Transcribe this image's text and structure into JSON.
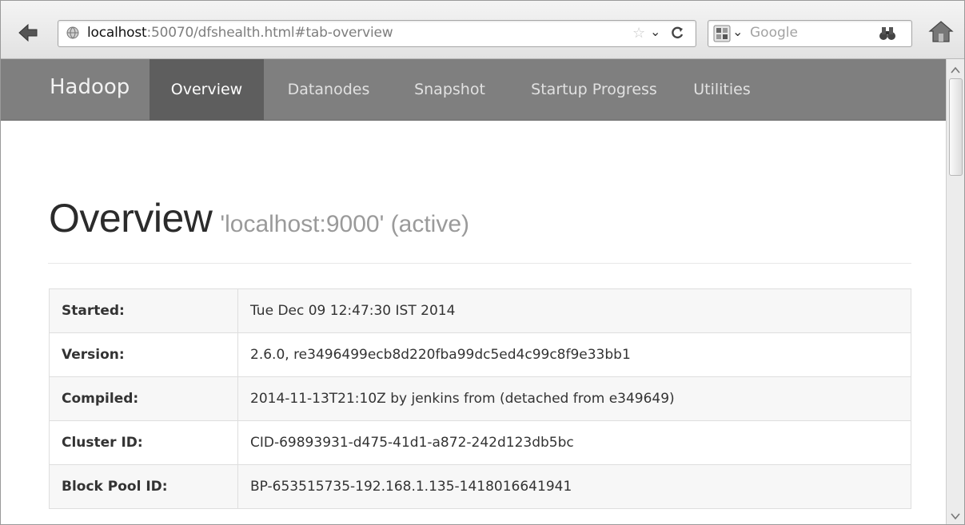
{
  "browser": {
    "url_host": "localhost",
    "url_rest": ":50070/dfshealth.html#tab-overview",
    "search_placeholder": "Google",
    "icons": {
      "back": "back-arrow-icon",
      "site": "globe-icon",
      "bookmark": "star-icon",
      "reload": "reload-icon",
      "engine": "google-icon",
      "search": "binoculars-icon",
      "home": "home-icon"
    }
  },
  "navbar": {
    "brand": "Hadoop",
    "items": [
      {
        "label": "Overview",
        "active": true
      },
      {
        "label": "Datanodes",
        "active": false
      },
      {
        "label": "Snapshot",
        "active": false
      },
      {
        "label": "Startup Progress",
        "active": false
      },
      {
        "label": "Utilities",
        "active": false
      }
    ],
    "colors": {
      "background": "#7f7f7f",
      "active": "#5e5e5e"
    }
  },
  "header": {
    "title": "Overview",
    "subtitle": "'localhost:9000' (active)"
  },
  "info_table": {
    "rows": [
      {
        "key": "Started:",
        "value": "Tue Dec 09 12:47:30 IST 2014"
      },
      {
        "key": "Version:",
        "value": "2.6.0, re3496499ecb8d220fba99dc5ed4c99c8f9e33bb1"
      },
      {
        "key": "Compiled:",
        "value": "2014-11-13T21:10Z by jenkins from (detached from e349649)"
      },
      {
        "key": "Cluster ID:",
        "value": "CID-69893931-d475-41d1-a872-242d123db5bc"
      },
      {
        "key": "Block Pool ID:",
        "value": "BP-653515735-192.168.1.135-1418016641941"
      }
    ]
  }
}
